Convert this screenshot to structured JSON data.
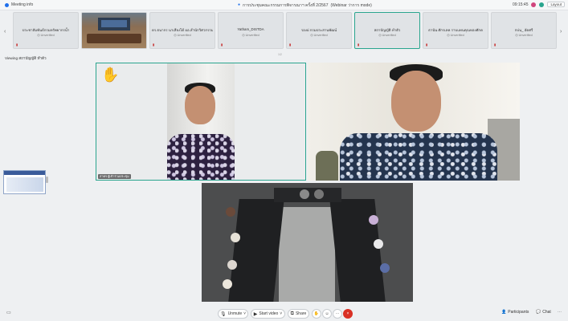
{
  "topbar": {
    "meeting_info": "Meeting info",
    "meeting_title": "การประชุมคณะกรรมการพิจารณาฯ ครั้งที่ 2/2567",
    "meeting_subtitle": "(Webinar ว่าการ mode)",
    "time": "09:15:45",
    "layout_label": "Layout",
    "accent": "#1f6feb"
  },
  "participants_strip": [
    {
      "name": "ประชาสัมพันธ์กรมทรัพยากรน้ำ",
      "status": "Unverified",
      "type": "avatar"
    },
    {
      "name": "",
      "status": "",
      "type": "video"
    },
    {
      "name": "ดร.ธนากร นาเสียงได้ ผอ.สำนักวิศวกรรม...",
      "status": "Unverified",
      "type": "avatar"
    },
    {
      "name": "Yatham_DISTDA",
      "status": "Unverified",
      "type": "avatar"
    },
    {
      "name": "รองผ่ กรมประสานพัฒน์",
      "status": "Unverified",
      "type": "avatar"
    },
    {
      "name": "สถาบัญญัติ ทำตัว",
      "status": "Unverified",
      "type": "avatar",
      "active": true
    },
    {
      "name": "ธานัน ศักรเลค ราบแทนคุณทองศักด",
      "status": "Unverified",
      "type": "avatar"
    },
    {
      "name": "กบ่น_ อัดศรี",
      "status": "Unverified",
      "type": "avatar"
    }
  ],
  "strip_pager": "1/2",
  "viewing_label": "Viewing สถาบัญญัติ ทำตัว",
  "video_tiles": [
    {
      "name": "สาคร",
      "sub": "ผู้เข้าร่วมประชุม",
      "raised_hand": true
    },
    {
      "name": ""
    },
    {
      "name": ""
    }
  ],
  "toolbar": {
    "unmute": "Unmute",
    "start_video": "Start video",
    "share": "Share",
    "participants": "Participants",
    "chat": "Chat",
    "more": "⋯",
    "leave_icon": "×"
  }
}
